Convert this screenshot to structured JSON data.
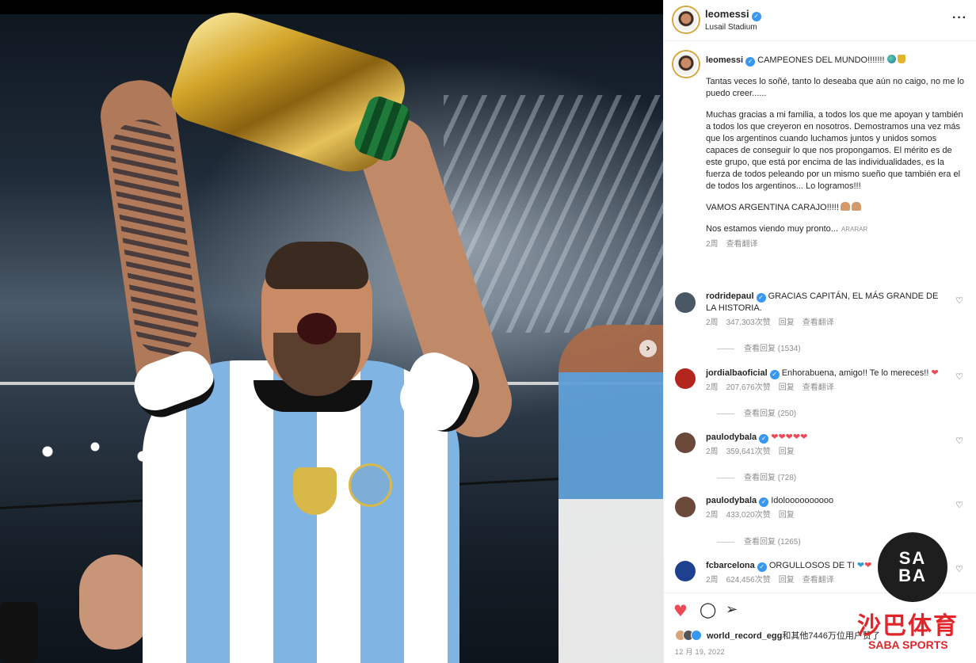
{
  "post": {
    "username": "leomessi",
    "location": "Lusail Stadium",
    "more_icon": "more-horizontal-icon"
  },
  "caption": {
    "username": "leomessi",
    "title": "CAMPEONES DEL MUNDO!!!!!!!",
    "p1": "Tantas veces lo soñé, tanto lo deseaba que aún no caigo, no me lo puedo creer......",
    "p2": "Muchas gracias a mi familia, a todos los que me apoyan y también a todos los que creyeron en nosotros. Demostramos una vez más que los argentinos cuando luchamos juntos y unidos somos capaces de conseguir lo que nos propongamos. El mérito es de este grupo, que está por encima de las individualidades, es la fuerza de todos peleando por un mismo sueño que también era el de todos los argentinos... Lo logramos!!!",
    "p3": "VAMOS ARGENTINA CARAJO!!!!!",
    "p4": "Nos estamos viendo muy pronto...",
    "p4_tag": "ARARAR",
    "time": "2周",
    "translate": "查看翻译"
  },
  "comments": [
    {
      "username": "rodridepaul",
      "text": "GRACIAS CAPITÁN, EL MÁS GRANDE DE LA HISTORIA.",
      "time": "2周",
      "likes": "347,303次赞",
      "reply": "回复",
      "translate": "查看翻译",
      "replies": "查看回复 (1534)",
      "avatar_color": "#4a5866"
    },
    {
      "username": "jordialbaoficial",
      "text": "Enhorabuena, amigo!! Te lo mereces!!",
      "heart": "❤",
      "time": "2周",
      "likes": "207,676次赞",
      "reply": "回复",
      "translate": "查看翻译",
      "replies": "查看回复 (250)",
      "avatar_color": "#b3261e"
    },
    {
      "username": "paulodybala",
      "text": "",
      "hearts": "❤❤❤❤❤",
      "time": "2周",
      "likes": "359,641次赞",
      "reply": "回复",
      "replies": "查看回复 (728)",
      "avatar_color": "#6b4a3a"
    },
    {
      "username": "paulodybala",
      "text": "Idoloooooooooo",
      "time": "2周",
      "likes": "433,020次赞",
      "reply": "回复",
      "replies": "查看回复 (1265)",
      "avatar_color": "#6b4a3a"
    },
    {
      "username": "fcbarcelona",
      "text": "ORGULLOSOS DE TI",
      "time": "2周",
      "likes": "624,456次赞",
      "reply": "回复",
      "translate": "查看翻译",
      "avatar_color": "#1f3f8f"
    }
  ],
  "actions": {
    "like_icon": "heart-icon",
    "comment_icon": "comment-icon",
    "share_icon": "send-icon",
    "save_icon": "bookmark-icon"
  },
  "likes_line": {
    "first_user": "world_record_egg",
    "rest": "和其他7446万位用户赞了"
  },
  "date": "12 月 19, 2022",
  "watermark": {
    "circle_top": "SA",
    "circle_bottom": "BA",
    "cn": "沙巴体育",
    "en": "SABA SPORTS"
  },
  "colors": {
    "verified": "#3897f0",
    "like_red": "#ed4956",
    "watermark_red": "#e0262a",
    "meta_gray": "#8e8e8e"
  }
}
